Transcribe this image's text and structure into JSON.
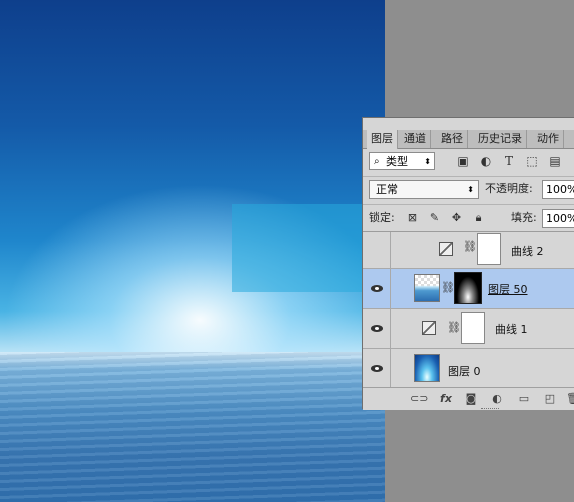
{
  "panel": {
    "tabs": [
      "图层",
      "通道",
      "路径",
      "历史记录",
      "动作"
    ],
    "filter": {
      "search_icon": "search-icon",
      "label": "类型"
    },
    "filter_icons": [
      "image-icon",
      "adjustment-icon",
      "text-icon",
      "shape-icon",
      "smart-object-icon"
    ],
    "blend_mode": "正常",
    "opacity_label": "不透明度:",
    "opacity_value": "100%",
    "lock_label": "锁定:",
    "lock_icons": [
      "lock-transparent-icon",
      "lock-paint-icon",
      "lock-move-icon",
      "lock-all-icon"
    ],
    "fill_label": "填充:",
    "fill_value": "100%",
    "layers": [
      {
        "name": "曲线 2",
        "type": "curves",
        "visible": false,
        "selected": false
      },
      {
        "name": "图层 50",
        "type": "pixel",
        "visible": true,
        "selected": true
      },
      {
        "name": "曲线 1",
        "type": "curves",
        "visible": true,
        "selected": false
      },
      {
        "name": "图层 0",
        "type": "pixel",
        "visible": true,
        "selected": false
      }
    ],
    "bottom_icons": [
      "link-icon",
      "fx-icon",
      "mask-icon",
      "adjustment-layer-icon",
      "folder-icon",
      "new-layer-icon",
      "trash-icon"
    ],
    "fx_label": "fx"
  }
}
